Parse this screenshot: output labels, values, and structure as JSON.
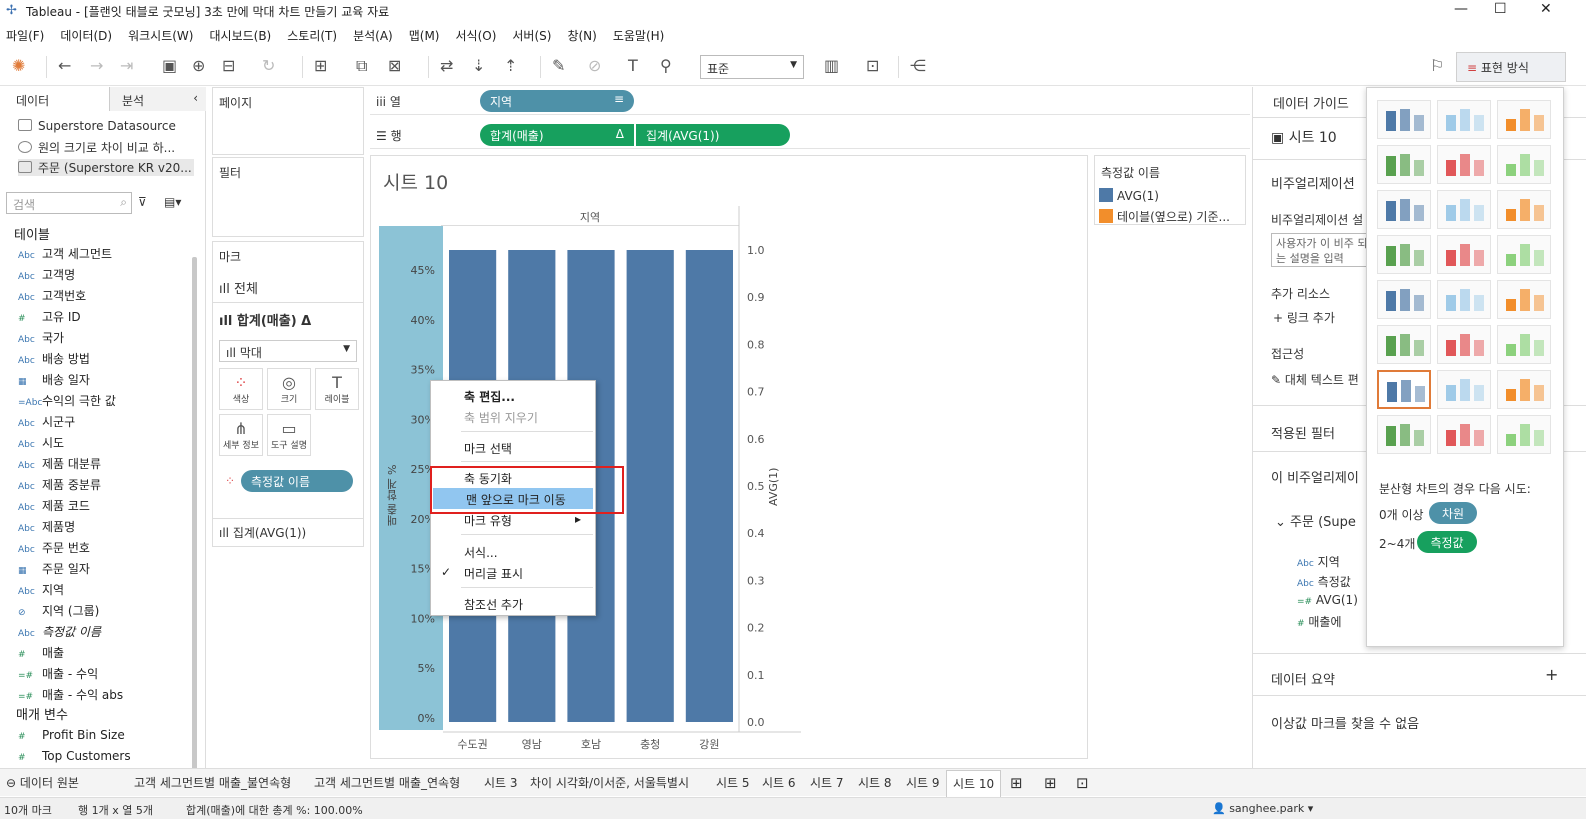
{
  "window": {
    "title": "Tableau - [플랜잇 태블로 굿모닝] 3초 만에 막대 차트 만들기 교육 자료",
    "min": "—",
    "max": "☐",
    "close": "✕"
  },
  "menu": [
    "파일(F)",
    "데이터(D)",
    "워크시트(W)",
    "대시보드(B)",
    "스토리(T)",
    "분석(A)",
    "맵(M)",
    "서식(O)",
    "서버(S)",
    "창(N)",
    "도움말(H)"
  ],
  "toolbar": {
    "fit": "표준",
    "show_me": "표현 방식"
  },
  "left": {
    "tab_data": "데이터",
    "tab_analysis": "분석",
    "datasources": [
      "Superstore Datasource",
      "원의 크기로 차이 비교 하...",
      "주문 (Superstore KR v20..."
    ],
    "search_placeholder": "검색",
    "tables_header": "테이블",
    "fields": [
      {
        "t": "Abc",
        "n": "고객 세그먼트"
      },
      {
        "t": "Abc",
        "n": "고객명"
      },
      {
        "t": "Abc",
        "n": "고객번호"
      },
      {
        "t": "#",
        "n": "고유 ID"
      },
      {
        "t": "Abc",
        "n": "국가"
      },
      {
        "t": "Abc",
        "n": "배송 방법"
      },
      {
        "t": "▦",
        "n": "배송 일자"
      },
      {
        "t": "=Abc",
        "n": "수익의 극한 값"
      },
      {
        "t": "Abc",
        "n": "시군구"
      },
      {
        "t": "Abc",
        "n": "시도"
      },
      {
        "t": "Abc",
        "n": "제품 대분류"
      },
      {
        "t": "Abc",
        "n": "제품 중분류"
      },
      {
        "t": "Abc",
        "n": "제품 코드"
      },
      {
        "t": "Abc",
        "n": "제품명"
      },
      {
        "t": "Abc",
        "n": "주문 번호"
      },
      {
        "t": "▦",
        "n": "주문 일자"
      },
      {
        "t": "Abc",
        "n": "지역"
      },
      {
        "t": "⊘",
        "n": "지역 (그룹)"
      },
      {
        "t": "Abc",
        "n": "측정값 이름"
      },
      {
        "t": "#",
        "n": "매출"
      },
      {
        "t": "=#",
        "n": "매출 - 수익"
      },
      {
        "t": "=#",
        "n": "매출 - 수익 abs"
      }
    ],
    "params_header": "매개 변수",
    "params": [
      "Profit Bin Size",
      "Top Customers"
    ]
  },
  "shelves": {
    "pages": "페이지",
    "filters": "필터",
    "marks": "마크",
    "all": "전체",
    "sum_sales": "합계(매출) Δ",
    "mark_type": "막대",
    "btn_color": "색상",
    "btn_size": "크기",
    "btn_label": "레이블",
    "btn_detail": "세부 정보",
    "btn_tooltip": "도구 설명",
    "measure_names_pill": "측정값 이름",
    "avg_card": "집계(AVG(1))"
  },
  "columns": {
    "label": "열",
    "pill": "지역"
  },
  "rows": {
    "label": "행",
    "pill1": "합계(매출)",
    "pill1_delta": "Δ",
    "pill2": "집계(AVG(1))"
  },
  "sheet": {
    "title": "시트 10",
    "col_header": "지역",
    "y_axis_title": "매출 합계 %",
    "y2_axis_title": "AVG(1)"
  },
  "chart_data": {
    "type": "bar",
    "categories": [
      "수도권",
      "영남",
      "호남",
      "충청",
      "강원"
    ],
    "series": [
      {
        "name": "AVG(1)",
        "values": [
          1.0,
          1.0,
          1.0,
          1.0,
          1.0
        ]
      }
    ],
    "y_ticks": [
      "45%",
      "40%",
      "35%",
      "30%",
      "25%",
      "20%",
      "15%",
      "10%",
      "5%",
      "0%"
    ],
    "y2_ticks": [
      "1.0",
      "0.9",
      "0.8",
      "0.7",
      "0.6",
      "0.5",
      "0.4",
      "0.3",
      "0.2",
      "0.1",
      "0.0"
    ],
    "ylim": [
      0,
      1.0
    ],
    "bar_color": "#4e79a7"
  },
  "legend": {
    "title": "측정값 이름",
    "items": [
      {
        "name": "AVG(1)",
        "color": "#4e79a7"
      },
      {
        "name": "테이블(옆으로) 기준...",
        "color": "#f28e2b"
      }
    ]
  },
  "context_menu": [
    {
      "label": "축 편집...",
      "state": "bold"
    },
    {
      "label": "축 범위 지우기",
      "state": "disabled"
    },
    {
      "label": "마크 선택",
      "state": "normal"
    },
    {
      "label": "축 동기화",
      "state": "normal"
    },
    {
      "label": "맨 앞으로 마크 이동",
      "state": "highlight"
    },
    {
      "label": "마크 유형",
      "state": "submenu"
    },
    {
      "label": "서식...",
      "state": "normal"
    },
    {
      "label": "머리글 표시",
      "state": "checked"
    },
    {
      "label": "참조선 추가",
      "state": "normal"
    }
  ],
  "guide": {
    "title": "데이터 가이드",
    "sheet": "시트 10",
    "viz_head": "비주얼리제이션",
    "viz_desc_label": "비주얼리제이션 설",
    "desc_placeholder": "사용자가 이 비주 되는 설명을 입력",
    "resources": "추가 리소스",
    "add_link": "링크 추가",
    "access": "접근성",
    "alt_text": "대체 텍스트 편",
    "applied_filters": "적용된 필터",
    "this_viz": "이 비주얼리제이",
    "source": "주문 (Supe",
    "fields": [
      "지역",
      "측정값",
      "AVG(1)",
      "매출에"
    ],
    "summary": "데이터 요약",
    "outliers": "이상값 마크를 찾을 수 없음"
  },
  "showme": {
    "hint": "분산형 차트의 경우 다음 시도:",
    "dim_count": "0개 이상",
    "dim_label": "차원",
    "mea_count": "2~4개",
    "mea_label": "측정값"
  },
  "tabs": [
    "데이터 원본",
    "고객 세그먼트별 매출_불연속형",
    "고객 세그먼트별 매출_연속형",
    "시트 3",
    "차이 시각화/이서준, 서울특별시",
    "시트 5",
    "시트 6",
    "시트 7",
    "시트 8",
    "시트 9",
    "시트 10"
  ],
  "status": {
    "marks": "10개 마크",
    "rows_cols": "행 1개 x 열 5개",
    "sum": "합계(매출)에 대한 총계 %: 100.00%",
    "user": "sanghee.park"
  }
}
